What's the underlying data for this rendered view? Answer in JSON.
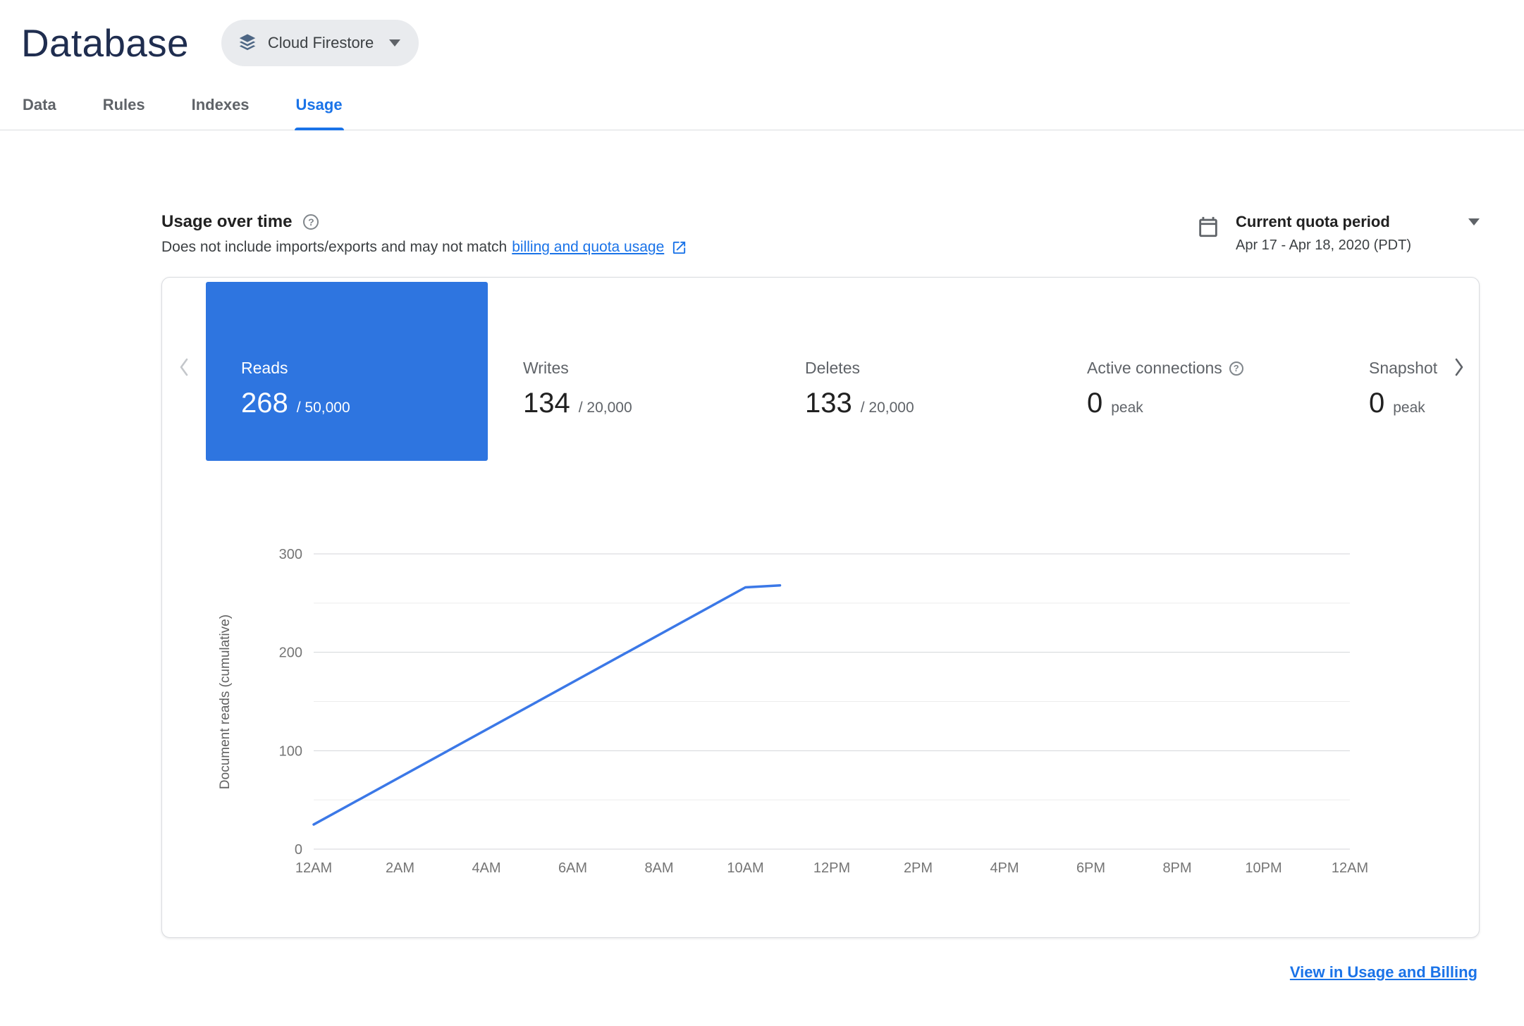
{
  "colors": {
    "accent": "#1a73e8",
    "selected_tile": "#2e75e0",
    "chart_line": "#3b78e7"
  },
  "header": {
    "title": "Database",
    "product": {
      "label": "Cloud Firestore"
    }
  },
  "tabs": [
    {
      "label": "Data",
      "active": false
    },
    {
      "label": "Rules",
      "active": false
    },
    {
      "label": "Indexes",
      "active": false
    },
    {
      "label": "Usage",
      "active": true
    }
  ],
  "usage_header": {
    "title": "Usage over time",
    "description_prefix": "Does not include imports/exports and may not match",
    "description_link": "billing and quota usage",
    "quota_period_label": "Current quota period",
    "quota_period_range": "Apr 17 - Apr 18, 2020 (PDT)"
  },
  "metrics": [
    {
      "label": "Reads",
      "value": "268",
      "suffix": "/ 50,000",
      "selected": true
    },
    {
      "label": "Writes",
      "value": "134",
      "suffix": "/ 20,000",
      "selected": false
    },
    {
      "label": "Deletes",
      "value": "133",
      "suffix": "/ 20,000",
      "selected": false
    },
    {
      "label": "Active connections",
      "value": "0",
      "suffix": "peak",
      "selected": false,
      "has_help": true
    },
    {
      "label": "Snapshot listeners",
      "value": "0",
      "suffix": "peak",
      "selected": false
    }
  ],
  "chart_data": {
    "type": "line",
    "title": "",
    "xlabel": "",
    "ylabel": "Document reads (cumulative)",
    "x_tick_labels": [
      "12AM",
      "2AM",
      "4AM",
      "6AM",
      "8AM",
      "10AM",
      "12PM",
      "2PM",
      "4PM",
      "6PM",
      "8PM",
      "10PM",
      "12AM"
    ],
    "x_range_hours": [
      0,
      24
    ],
    "ylim": [
      0,
      300
    ],
    "y_ticks_labeled": [
      0,
      100,
      200,
      300
    ],
    "y_gridline_step": 50,
    "grid": true,
    "legend": false,
    "series": [
      {
        "name": "Document reads (cumulative)",
        "color": "#3b78e7",
        "points_hour_value": [
          [
            0,
            25
          ],
          [
            10,
            266
          ],
          [
            10.8,
            268
          ]
        ]
      }
    ]
  },
  "footer": {
    "billing_link": "View in Usage and Billing"
  }
}
